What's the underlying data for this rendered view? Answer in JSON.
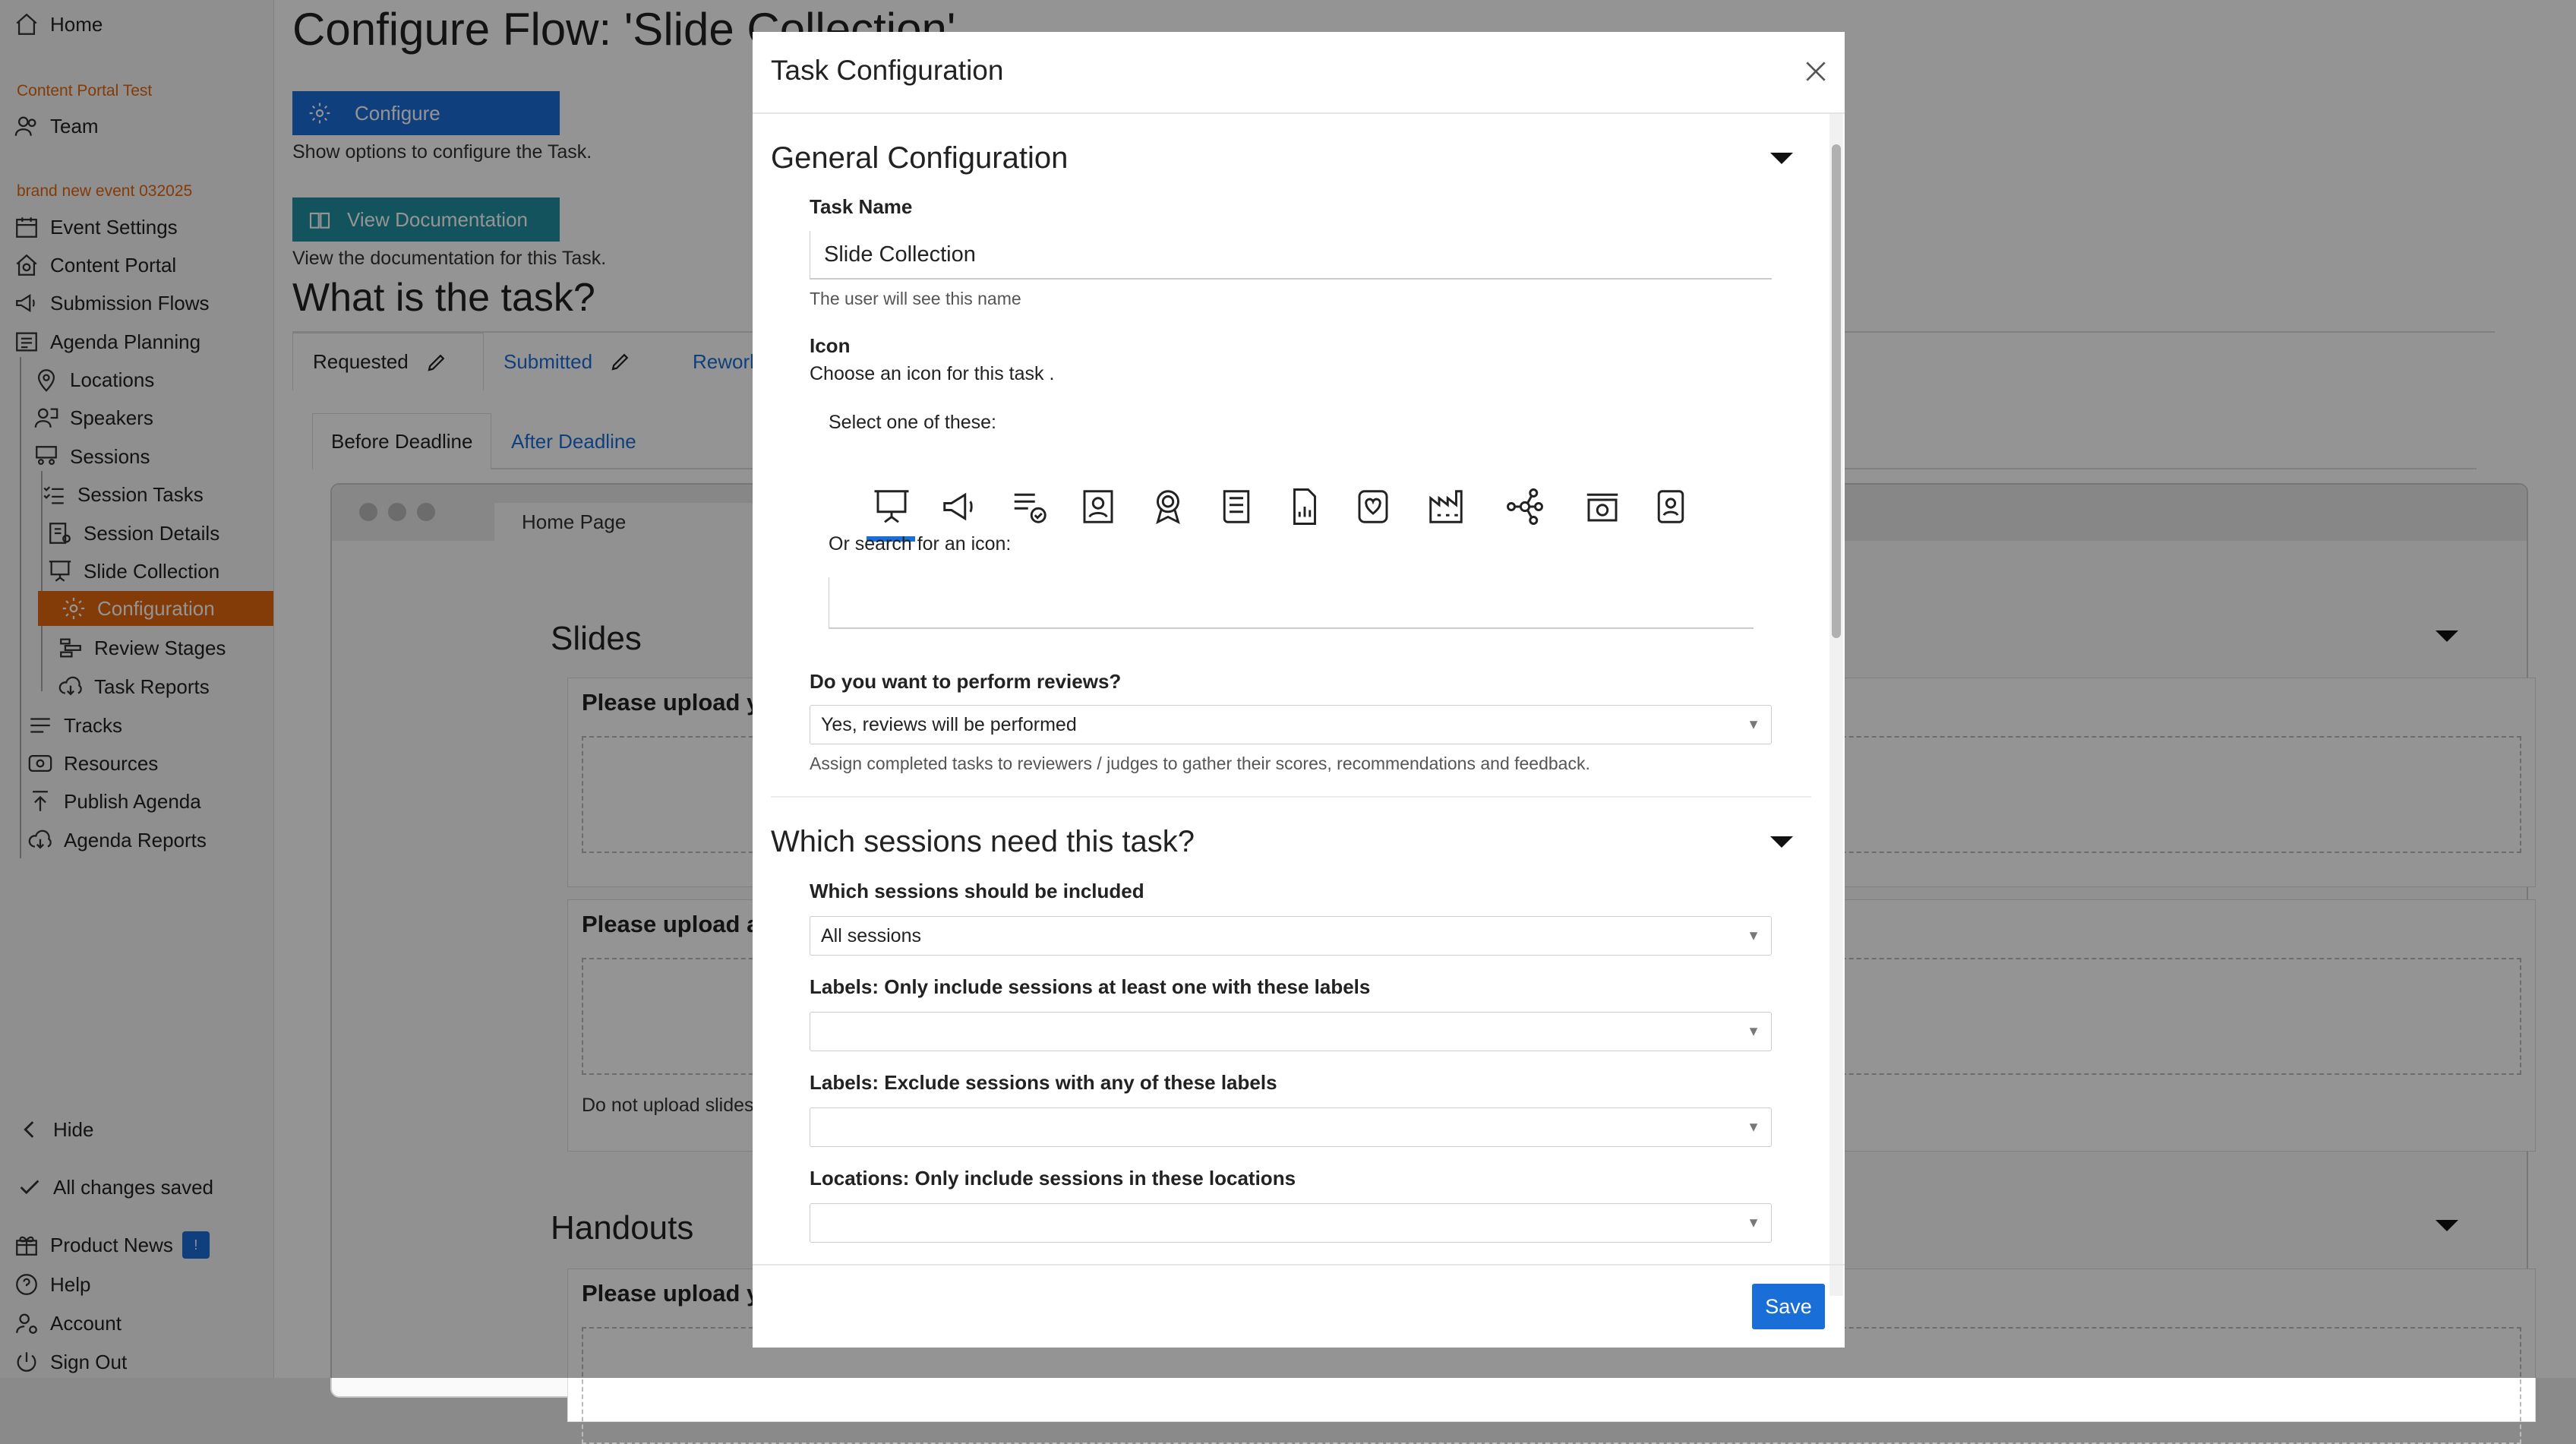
{
  "sidebar": {
    "home": "Home",
    "group1": "Content Portal Test",
    "team": "Team",
    "group2": "brand new event 032025",
    "items": {
      "event_settings": "Event Settings",
      "content_portal": "Content Portal",
      "submission_flows": "Submission Flows",
      "agenda_planning": "Agenda Planning",
      "locations": "Locations",
      "speakers": "Speakers",
      "sessions": "Sessions",
      "session_tasks": "Session Tasks",
      "session_details": "Session Details",
      "slide_collection": "Slide Collection",
      "configuration": "Configuration",
      "review_stages": "Review Stages",
      "task_reports": "Task Reports",
      "tracks": "Tracks",
      "resources": "Resources",
      "publish_agenda": "Publish Agenda",
      "agenda_reports": "Agenda Reports"
    },
    "hide": "Hide",
    "saved": "All changes saved",
    "product_news": "Product News",
    "news_badge": "!",
    "help": "Help",
    "account": "Account",
    "sign_out": "Sign Out"
  },
  "main": {
    "title": "Configure Flow: 'Slide Collection'",
    "configure_btn": "Configure",
    "configure_desc": "Show options to configure the Task.",
    "docs_btn": "View Documentation",
    "docs_desc": "View the documentation for this Task.",
    "question": "What is the task?",
    "tabs": [
      "Requested",
      "Submitted",
      "Rework"
    ],
    "subtabs": [
      "Before Deadline",
      "After Deadline"
    ],
    "browser_tab": "Home Page",
    "slides_heading": "Slides",
    "upload1": "Please upload yo",
    "upload2": "Please upload an",
    "no_upload": "Do not upload slides",
    "handouts_heading": "Handouts",
    "upload3": "Please upload yo"
  },
  "modal": {
    "title": "Task Configuration",
    "general_heading": "General Configuration",
    "task_name_label": "Task Name",
    "task_name_value": "Slide Collection",
    "task_name_help": "The user will see this name",
    "icon_label": "Icon",
    "icon_desc": "Choose an icon for this task .",
    "select_one": "Select one of these:",
    "icons": [
      "presentation-icon",
      "megaphone-icon",
      "checklist-icon",
      "contact-card-icon",
      "award-icon",
      "book-icon",
      "report-document-icon",
      "badge-heart-icon",
      "factory-icon",
      "network-icon",
      "photo-box-icon",
      "id-badge-icon"
    ],
    "search_label": "Or search for an icon:",
    "search_value": "",
    "reviews_label": "Do you want to perform reviews?",
    "reviews_value": "Yes, reviews will be performed",
    "reviews_help": "Assign completed tasks to reviewers / judges to gather their scores, recommendations and feedback.",
    "sessions_heading": "Which sessions need this task?",
    "include_label": "Which sessions should be included",
    "include_value": "All sessions",
    "labels_include_label": "Labels: Only include sessions at least one with these labels",
    "labels_exclude_label": "Labels: Exclude sessions with any of these labels",
    "locations_label": "Locations: Only include sessions in these locations",
    "save": "Save"
  },
  "colors": {
    "accent": "#1a6ed8",
    "teal": "#1f8fa3",
    "active_item": "#e2670f",
    "group_label": "#e2670f"
  }
}
